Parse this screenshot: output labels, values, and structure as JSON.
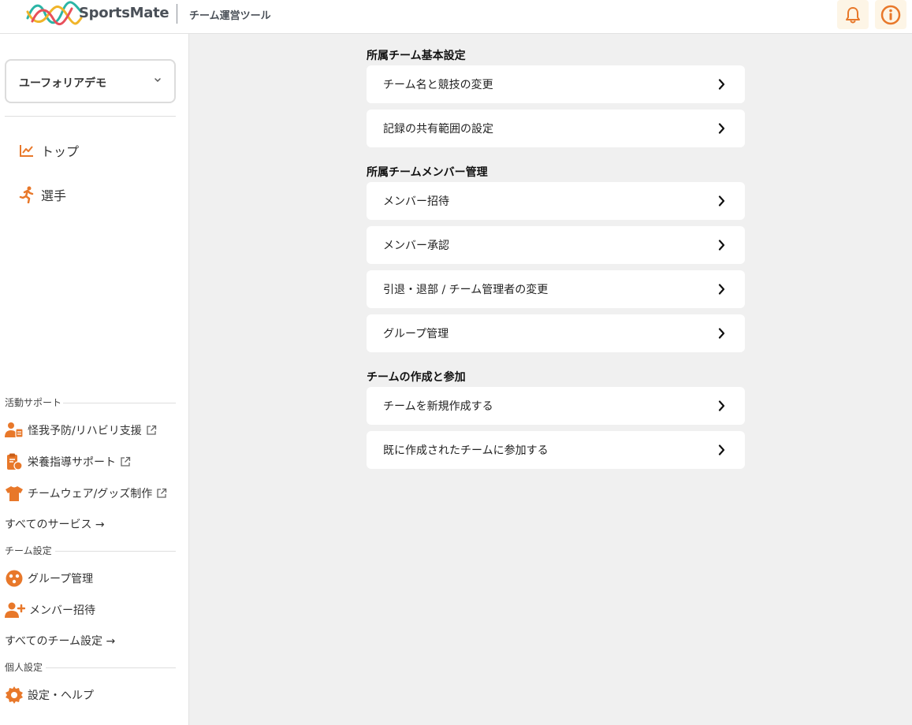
{
  "header": {
    "brand": "SportsMate",
    "tool_name": "チーム運営ツール",
    "accent_color": "#e8782a"
  },
  "sidebar": {
    "team_selector": {
      "value": "ユーフォリアデモ"
    },
    "nav": [
      {
        "label": "トップ",
        "icon": "chart-line-icon"
      },
      {
        "label": "選手",
        "icon": "runner-icon"
      }
    ],
    "activity_support": {
      "label": "活動サポート",
      "items": [
        {
          "label": "怪我予防/リハビリ支援",
          "icon": "rehab-support-icon"
        },
        {
          "label": "栄養指導サポート",
          "icon": "nutrition-clipboard-icon"
        },
        {
          "label": "チームウェア/グッズ制作",
          "icon": "tshirt-icon"
        }
      ],
      "all_link": "すべてのサービス →"
    },
    "team_settings": {
      "label": "チーム設定",
      "items": [
        {
          "label": "グループ管理",
          "icon": "group-icon"
        },
        {
          "label": "メンバー招待",
          "icon": "user-plus-icon"
        }
      ],
      "all_link": "すべてのチーム設定 →"
    },
    "personal_settings": {
      "label": "個人設定",
      "items": [
        {
          "label": "設定・ヘルプ",
          "icon": "gear-icon"
        }
      ]
    }
  },
  "main": {
    "sections": [
      {
        "title": "所属チーム基本設定",
        "items": [
          "チーム名と競技の変更",
          "記録の共有範囲の設定"
        ]
      },
      {
        "title": "所属チームメンバー管理",
        "items": [
          "メンバー招待",
          "メンバー承認",
          "引退・退部 / チーム管理者の変更",
          "グループ管理"
        ]
      },
      {
        "title": "チームの作成と参加",
        "items": [
          "チームを新規作成する",
          "既に作成されたチームに参加する"
        ]
      }
    ]
  }
}
